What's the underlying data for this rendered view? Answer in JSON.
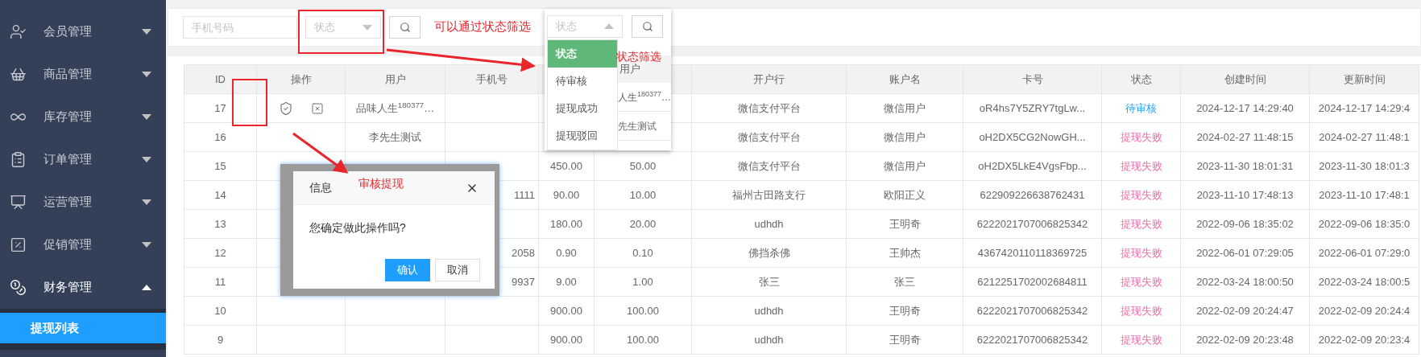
{
  "sidebar": {
    "items": [
      {
        "label": "会员管理",
        "expanded": false
      },
      {
        "label": "商品管理",
        "expanded": false
      },
      {
        "label": "库存管理",
        "expanded": false
      },
      {
        "label": "订单管理",
        "expanded": false
      },
      {
        "label": "运营管理",
        "expanded": false
      },
      {
        "label": "促销管理",
        "expanded": false
      },
      {
        "label": "财务管理",
        "expanded": true,
        "children": [
          {
            "label": "提现列表",
            "selected": true
          }
        ]
      }
    ]
  },
  "filters": {
    "phone": {
      "placeholder": "手机号码"
    },
    "status": {
      "placeholder": "状态",
      "open": false
    }
  },
  "status_menu_snapshot": {
    "select": {
      "placeholder": "状态",
      "open": true
    },
    "options": [
      {
        "label": "状态",
        "selected": true
      },
      {
        "label": "待审核",
        "selected": false
      },
      {
        "label": "提现成功",
        "selected": false
      },
      {
        "label": "提现驳回",
        "selected": false
      }
    ],
    "peek": {
      "header": "用户",
      "cells": [
        "人生$^{180377}$…",
        "先生测试"
      ]
    }
  },
  "table": {
    "columns": [
      {
        "label": "ID"
      },
      {
        "label": "操作"
      },
      {
        "label": "用户"
      },
      {
        "label": "手机号"
      },
      {},
      {},
      {
        "label": "开户行"
      },
      {
        "label": "账户名"
      },
      {
        "label": "卡号"
      },
      {
        "label": "状态"
      },
      {
        "label": "创建时间"
      },
      {
        "label": "更新时间"
      }
    ],
    "rows": [
      {
        "id": "17",
        "actions": [
          {
            "kind": "approve"
          },
          {
            "kind": "reject"
          }
        ],
        "user": "品味人生$^{180377}$…",
        "bank": "微信支付平台",
        "account_name": "微信用户",
        "card": "oR4hs7Y5ZRY7tgLw...",
        "status": {
          "label": "待审核",
          "kind": "pending"
        },
        "created": "2024-12-17 14:29:40",
        "updated": "2024-12-17 14:29:4"
      },
      {
        "id": "16",
        "user": "李先生测试",
        "bank": "微信支付平台",
        "account_name": "微信用户",
        "card": "oH2DX5CG2NowGH...",
        "status": {
          "label": "提现失败",
          "kind": "failed"
        },
        "created": "2024-02-27 11:48:15",
        "updated": "2024-02-27 11:48:1"
      },
      {
        "id": "15",
        "column_5": "450.00",
        "column_6": "50.00",
        "bank": "微信支付平台",
        "account_name": "微信用户",
        "card": "oH2DX5LkE4VgsFbp...",
        "status": {
          "label": "提现失败",
          "kind": "failed"
        },
        "created": "2023-11-30 18:01:31",
        "updated": "2023-11-30 18:01:3"
      },
      {
        "id": "14",
        "phone": "1111",
        "column_5": "90.00",
        "column_6": "10.00",
        "bank": "福州古田路支行",
        "account_name": "欧阳正义",
        "card": "622909226638762431",
        "status": {
          "label": "提现失败",
          "kind": "failed"
        },
        "created": "2023-11-10 17:48:13",
        "updated": "2023-11-10 17:48:1"
      },
      {
        "id": "13",
        "column_5": "180.00",
        "column_6": "20.00",
        "bank": "udhdh",
        "account_name": "王明奇",
        "card": "6222021707006825342",
        "status": {
          "label": "提现失败",
          "kind": "failed"
        },
        "created": "2022-09-06 18:35:02",
        "updated": "2022-09-06 18:35:0"
      },
      {
        "id": "12",
        "phone": "2058",
        "column_5": "0.90",
        "column_6": "0.10",
        "bank": "佛挡杀佛",
        "account_name": "王帅杰",
        "card": "4367420110118369725",
        "status": {
          "label": "提现失败",
          "kind": "failed"
        },
        "created": "2022-06-01 07:29:05",
        "updated": "2022-06-01 07:29:0"
      },
      {
        "id": "11",
        "phone": "9937",
        "column_5": "9.00",
        "column_6": "1.00",
        "bank": "张三",
        "account_name": "张三",
        "card": "6212251702002684811",
        "status": {
          "label": "提现失败",
          "kind": "failed"
        },
        "created": "2022-03-24 18:00:50",
        "updated": "2022-03-24 18:00:5"
      },
      {
        "id": "10",
        "column_5": "900.00",
        "column_6": "100.00",
        "bank": "udhdh",
        "account_name": "王明奇",
        "card": "6222021707006825342",
        "status": {
          "label": "提现失败",
          "kind": "failed"
        },
        "created": "2022-02-09 20:24:47",
        "updated": "2022-02-09 20:24:4"
      },
      {
        "id": "9",
        "column_5": "900.00",
        "column_6": "100.00",
        "bank": "udhdh",
        "account_name": "王明奇",
        "card": "6222021707006825342",
        "status": {
          "label": "提现失败",
          "kind": "failed"
        },
        "created": "2022-02-09 20:23:48",
        "updated": "2022-02-09 20:23:4"
      }
    ]
  },
  "dialog": {
    "title": "信息",
    "message": "您确定做此操作吗?",
    "buttons": [
      {
        "label": "确认",
        "primary": true
      },
      {
        "label": "取消",
        "primary": false
      }
    ]
  },
  "annotations": [
    {
      "text": "可以通过状态筛选"
    },
    {
      "text": "状态筛选"
    },
    {
      "text": "审核提现"
    }
  ]
}
